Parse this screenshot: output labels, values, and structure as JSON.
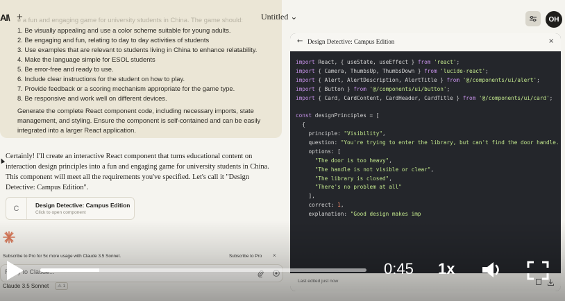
{
  "topbar": {
    "logo": "AI\\",
    "new_chat": "+",
    "doc_title": "Untitled ⌄",
    "avatar": "OH"
  },
  "user_message": {
    "faded_line": "e a fun and engaging game for university students in China. The game should:",
    "requirements": [
      "1. Be visually appealing and use a color scheme suitable for young adults.",
      "2. Be engaging and fun, relating to day to day activities of students",
      "3. Use examples that are relevant to students living in China to enhance relatability.",
      "4. Make the language simple for ESOL students",
      "5. Be error-free and ready to use.",
      "6. Include clear instructions for the student on how to play.",
      "7. Provide feedback or a scoring mechanism appropriate for the game type.",
      "8. Be responsive and work well on different devices."
    ],
    "generate": "Generate the complete React component code, including necessary imports, state management, and styling. Ensure the component is self-contained and can be easily integrated into a larger React application."
  },
  "assistant_message": {
    "text": "Certainly! I'll create an interactive React component that turns educational content on interaction design principles into a fun and engaging game for university students in China. This component will meet all the requirements you've specified. Let's call it \"Design Detective: Campus Edition\"."
  },
  "artifact_card": {
    "icon": "C",
    "title": "Design Detective: Campus Edition",
    "subtitle": "Click to open component"
  },
  "promo": {
    "text": "Subscribe to Pro for 5x more usage with Claude 3.5 Sonnet.",
    "cta": "Subscribe to Pro",
    "close": "×"
  },
  "input": {
    "placeholder": "Reply to Claude..."
  },
  "model": {
    "name": "Claude 3.5 Sonnet",
    "badge": "⚠ 1"
  },
  "panel": {
    "back": "←",
    "title": "Design Detective: Campus Edition",
    "close": "×",
    "footer": "Last edited just now",
    "code_lines": [
      [
        {
          "t": "import ",
          "c": "kw"
        },
        {
          "t": "React, { useState, useEffect } ",
          "c": "prop"
        },
        {
          "t": "from ",
          "c": "kw"
        },
        {
          "t": "'react'",
          "c": "str"
        },
        {
          "t": ";",
          "c": "prop"
        }
      ],
      [
        {
          "t": "import ",
          "c": "kw"
        },
        {
          "t": "{ Camera, ThumbsUp, ThumbsDown } ",
          "c": "prop"
        },
        {
          "t": "from ",
          "c": "kw"
        },
        {
          "t": "'lucide-react'",
          "c": "str"
        },
        {
          "t": ";",
          "c": "prop"
        }
      ],
      [
        {
          "t": "import ",
          "c": "kw"
        },
        {
          "t": "{ Alert, AlertDescription, AlertTitle } ",
          "c": "prop"
        },
        {
          "t": "from ",
          "c": "kw"
        },
        {
          "t": "'@/components/ui/alert'",
          "c": "str"
        },
        {
          "t": ";",
          "c": "prop"
        }
      ],
      [
        {
          "t": "import ",
          "c": "kw"
        },
        {
          "t": "{ Button } ",
          "c": "prop"
        },
        {
          "t": "from ",
          "c": "kw"
        },
        {
          "t": "'@/components/ui/button'",
          "c": "str"
        },
        {
          "t": ";",
          "c": "prop"
        }
      ],
      [
        {
          "t": "import ",
          "c": "kw"
        },
        {
          "t": "{ Card, CardContent, CardHeader, CardTitle } ",
          "c": "prop"
        },
        {
          "t": "from ",
          "c": "kw"
        },
        {
          "t": "'@/components/ui/card'",
          "c": "str"
        },
        {
          "t": ";",
          "c": "prop"
        }
      ],
      [],
      [
        {
          "t": "const ",
          "c": "kw"
        },
        {
          "t": "designPrinciples = [",
          "c": "prop"
        }
      ],
      [
        {
          "t": "  {",
          "c": "prop"
        }
      ],
      [
        {
          "t": "    principle: ",
          "c": "prop"
        },
        {
          "t": "\"Visibility\"",
          "c": "str"
        },
        {
          "t": ",",
          "c": "prop"
        }
      ],
      [
        {
          "t": "    question: ",
          "c": "prop"
        },
        {
          "t": "\"You're trying to enter the library, but can't find the door handle.",
          "c": "str"
        }
      ],
      [
        {
          "t": "    options: [",
          "c": "prop"
        }
      ],
      [
        {
          "t": "      ",
          "c": "prop"
        },
        {
          "t": "\"The door is too heavy\"",
          "c": "str"
        },
        {
          "t": ",",
          "c": "prop"
        }
      ],
      [
        {
          "t": "      ",
          "c": "prop"
        },
        {
          "t": "\"The handle is not visible or clear\"",
          "c": "str"
        },
        {
          "t": ",",
          "c": "prop"
        }
      ],
      [
        {
          "t": "      ",
          "c": "prop"
        },
        {
          "t": "\"The library is closed\"",
          "c": "str"
        },
        {
          "t": ",",
          "c": "prop"
        }
      ],
      [
        {
          "t": "      ",
          "c": "prop"
        },
        {
          "t": "\"There's no problem at all\"",
          "c": "str"
        }
      ],
      [
        {
          "t": "    ],",
          "c": "prop"
        }
      ],
      [
        {
          "t": "    correct: ",
          "c": "prop"
        },
        {
          "t": "1",
          "c": "num"
        },
        {
          "t": ",",
          "c": "prop"
        }
      ],
      [
        {
          "t": "    explanation: ",
          "c": "prop"
        },
        {
          "t": "\"Good design makes imp",
          "c": "str"
        }
      ]
    ]
  },
  "video": {
    "time": "0:45",
    "speed": "1x",
    "progress_fraction": 0.18
  },
  "colors": {
    "background": "#f5f4ef",
    "user_card": "#ebe6d6",
    "code_bg": "#24262b",
    "keyword": "#c792ea",
    "string": "#c3e88d",
    "number": "#f78c6c",
    "accent": "#d97757"
  },
  "icons": [
    "settings-sliders-icon",
    "claude-spark-icon",
    "paperclip-icon",
    "send-icon",
    "copy-icon",
    "download-icon",
    "play-icon",
    "volume-icon",
    "fullscreen-icon"
  ]
}
